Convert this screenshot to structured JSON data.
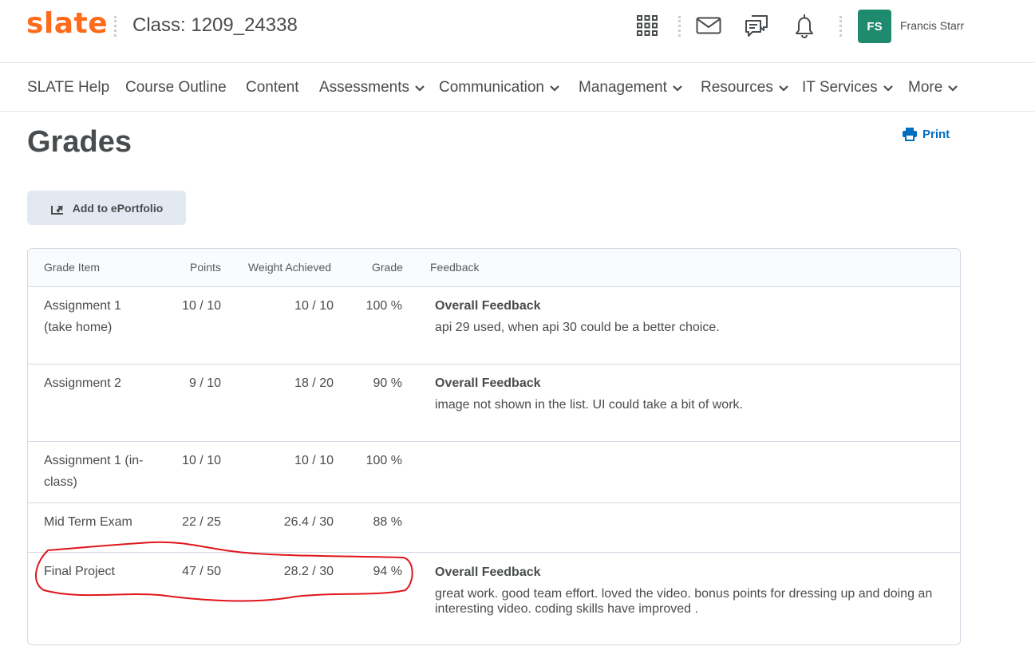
{
  "header": {
    "logo": "slate",
    "class_title": "Class: 1209_24338",
    "user_initials": "FS",
    "user_name": "Francis Starr",
    "icons": [
      "apps-grid-icon",
      "mail-icon",
      "chat-icon",
      "bell-icon"
    ]
  },
  "nav": {
    "items": [
      {
        "label": "SLATE Help",
        "dropdown": false
      },
      {
        "label": "Course Outline",
        "dropdown": false
      },
      {
        "label": "Content",
        "dropdown": false
      },
      {
        "label": "Assessments",
        "dropdown": true
      },
      {
        "label": "Communication",
        "dropdown": true
      },
      {
        "label": "Management",
        "dropdown": true
      },
      {
        "label": "Resources",
        "dropdown": true
      },
      {
        "label": "IT Services",
        "dropdown": true
      },
      {
        "label": "More",
        "dropdown": true
      }
    ]
  },
  "page": {
    "title": "Grades",
    "print_label": "Print",
    "eportfolio_label": "Add to ePortfolio"
  },
  "grades": {
    "columns": [
      "Grade Item",
      "Points",
      "Weight Achieved",
      "Grade",
      "Feedback"
    ],
    "rows": [
      {
        "item_line1": "Assignment 1",
        "item_line2": "(take home)",
        "points": "10 / 10",
        "weight": "10 / 10",
        "grade": "100 %",
        "feedback_title": "Overall Feedback",
        "feedback_text": "api 29 used, when api 30 could be a better choice."
      },
      {
        "item_line1": "Assignment 2",
        "item_line2": "",
        "points": "9 / 10",
        "weight": "18 / 20",
        "grade": "90 %",
        "feedback_title": "Overall Feedback",
        "feedback_text": "image not shown in the list. UI could take a bit of work."
      },
      {
        "item_line1": "Assignment 1 (in-",
        "item_line2": "class)",
        "points": "10 / 10",
        "weight": "10 / 10",
        "grade": "100 %",
        "feedback_title": "",
        "feedback_text": ""
      },
      {
        "item_line1": "Mid Term Exam",
        "item_line2": "",
        "points": "22 / 25",
        "weight": "26.4 / 30",
        "grade": "88 %",
        "feedback_title": "",
        "feedback_text": ""
      },
      {
        "item_line1": "Final Project",
        "item_line2": "",
        "points": "47 / 50",
        "weight": "28.2 / 30",
        "grade": "94 %",
        "feedback_title": "Overall Feedback",
        "feedback_text": "great work. good team effort. loved the video. bonus points for dressing up and doing an",
        "feedback_text_2": "interesting video. coding skills have improved ."
      }
    ]
  },
  "colors": {
    "logo": "#ff6b1a",
    "avatar": "#1e8a6e",
    "link": "#006fbf",
    "annotation": "#e0161b"
  }
}
